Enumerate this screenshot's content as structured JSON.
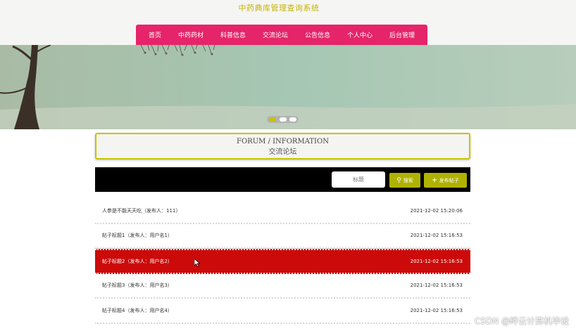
{
  "site": {
    "title": "中药典库管理查询系统"
  },
  "nav": {
    "items": [
      {
        "label": "首页"
      },
      {
        "label": "中药药材"
      },
      {
        "label": "科普信息"
      },
      {
        "label": "交流论坛"
      },
      {
        "label": "公告信息"
      },
      {
        "label": "个人中心"
      },
      {
        "label": "后台管理"
      }
    ],
    "color": "#e6246a"
  },
  "banner": {
    "slide_count": 3,
    "active_slide": 1
  },
  "forum": {
    "title_en": "FORUM / INFORMATION",
    "title_cn": "交流论坛",
    "accent": "#c8c400"
  },
  "search": {
    "placeholder": "标题",
    "search_label": "搜索",
    "post_label": "发布帖子",
    "button_color": "#b0b200"
  },
  "posts": [
    {
      "title": "人参是不能天天吃（发布人：111）",
      "time": "2021-12-02 15:20:06"
    },
    {
      "title": "帖子标题1（发布人：用户名1）",
      "time": "2021-12-02 15:16:53"
    },
    {
      "title": "帖子标题2（发布人：用户名2）",
      "time": "2021-12-02 15:16:53",
      "highlighted": true
    },
    {
      "title": "帖子标题3（发布人：用户名3）",
      "time": "2021-12-02 15:16:53"
    },
    {
      "title": "帖子标题4（发布人：用户名4）",
      "time": "2021-12-02 15:16:53"
    }
  ],
  "highlight_color": "#cc0a0a",
  "watermark": "CSDN @畔云计算机毕设"
}
